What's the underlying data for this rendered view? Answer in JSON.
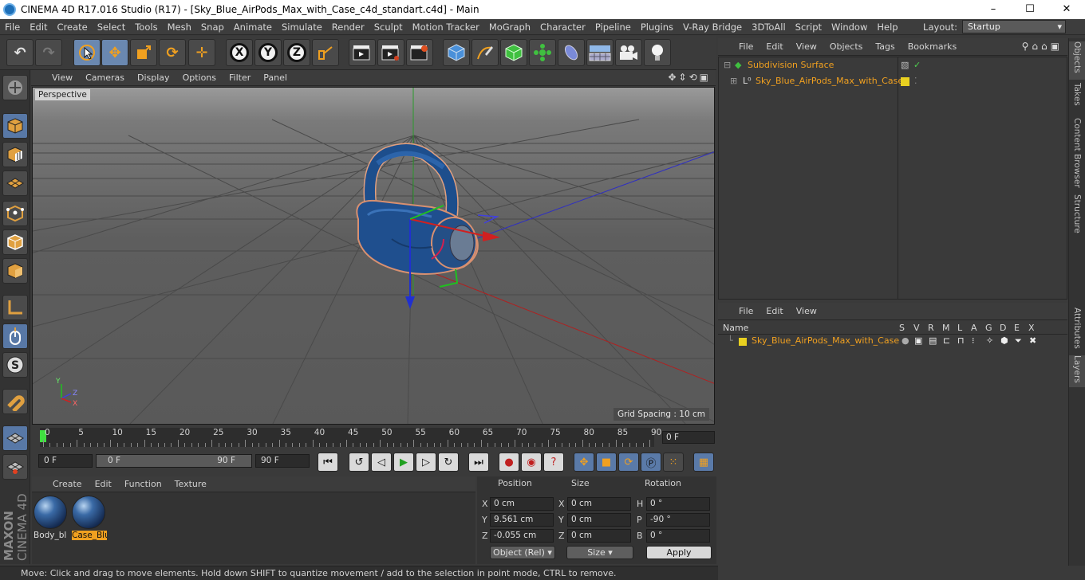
{
  "window": {
    "title": "CINEMA 4D R17.016 Studio (R17) - [Sky_Blue_AirPods_Max_with_Case_c4d_standart.c4d] - Main",
    "controls": [
      "–",
      "☐",
      "✕"
    ]
  },
  "menubar": {
    "items": [
      "File",
      "Edit",
      "Create",
      "Select",
      "Tools",
      "Mesh",
      "Snap",
      "Animate",
      "Simulate",
      "Render",
      "Sculpt",
      "Motion Tracker",
      "MoGraph",
      "Character",
      "Pipeline",
      "Plugins",
      "V-Ray Bridge",
      "3DToAll",
      "Script",
      "Window",
      "Help"
    ],
    "layout_label": "Layout:",
    "layout_value": "Startup"
  },
  "viewport": {
    "menu": [
      "View",
      "Cameras",
      "Display",
      "Options",
      "Filter",
      "Panel"
    ],
    "camera_label": "Perspective",
    "grid_spacing": "Grid Spacing : 10 cm",
    "axis_letters": {
      "y": "Y",
      "z": "Z",
      "x": "X"
    }
  },
  "timeline": {
    "ticks": [
      "0",
      "5",
      "10",
      "15",
      "20",
      "25",
      "30",
      "35",
      "40",
      "45",
      "50",
      "55",
      "60",
      "65",
      "70",
      "75",
      "80",
      "85",
      "90"
    ],
    "current_frame": "0 F"
  },
  "transport": {
    "start_frame": "0 F",
    "range_start": "0 F",
    "range_end": "90 F",
    "end_frame": "90 F"
  },
  "materials": {
    "menu": [
      "Create",
      "Edit",
      "Function",
      "Texture"
    ],
    "items": [
      {
        "name": "Body_bl",
        "selected": false
      },
      {
        "name": "Case_Blu",
        "selected": true
      }
    ]
  },
  "coordinates": {
    "headers": {
      "position": "Position",
      "size": "Size",
      "rotation": "Rotation"
    },
    "rows": [
      {
        "pos_axis": "X",
        "pos": "0 cm",
        "size_axis": "X",
        "size": "0 cm",
        "rot_axis": "H",
        "rot": "0 °"
      },
      {
        "pos_axis": "Y",
        "pos": "9.561 cm",
        "size_axis": "Y",
        "size": "0 cm",
        "rot_axis": "P",
        "rot": "-90 °"
      },
      {
        "pos_axis": "Z",
        "pos": "-0.055 cm",
        "size_axis": "Z",
        "size": "0 cm",
        "rot_axis": "B",
        "rot": "0 °"
      }
    ],
    "mode": "Object (Rel)",
    "size_mode": "Size",
    "apply": "Apply"
  },
  "status": "Move: Click and drag to move elements. Hold down SHIFT to quantize movement / add to the selection in point mode, CTRL to remove.",
  "brand": {
    "maxon": "MAXON",
    "c4d": "CINEMA 4D"
  },
  "objects": {
    "menu": [
      "File",
      "Edit",
      "View",
      "Objects",
      "Tags",
      "Bookmarks"
    ],
    "items": [
      {
        "name": "Subdivision Surface"
      },
      {
        "name": "Sky_Blue_AirPods_Max_with_Case"
      }
    ]
  },
  "layers": {
    "menu": [
      "File",
      "Edit",
      "View"
    ],
    "columns": [
      "Name",
      "S",
      "V",
      "R",
      "M",
      "L",
      "A",
      "G",
      "D",
      "E",
      "X"
    ],
    "items": [
      {
        "name": "Sky_Blue_AirPods_Max_with_Case"
      }
    ]
  },
  "side_tabs": [
    "Objects",
    "Takes",
    "Content Browser",
    "Structure",
    "Attributes",
    "Layers"
  ],
  "colors": {
    "accent": "#f0a020",
    "selection": "#6a88b0",
    "layer_yellow": "#e8d020"
  }
}
